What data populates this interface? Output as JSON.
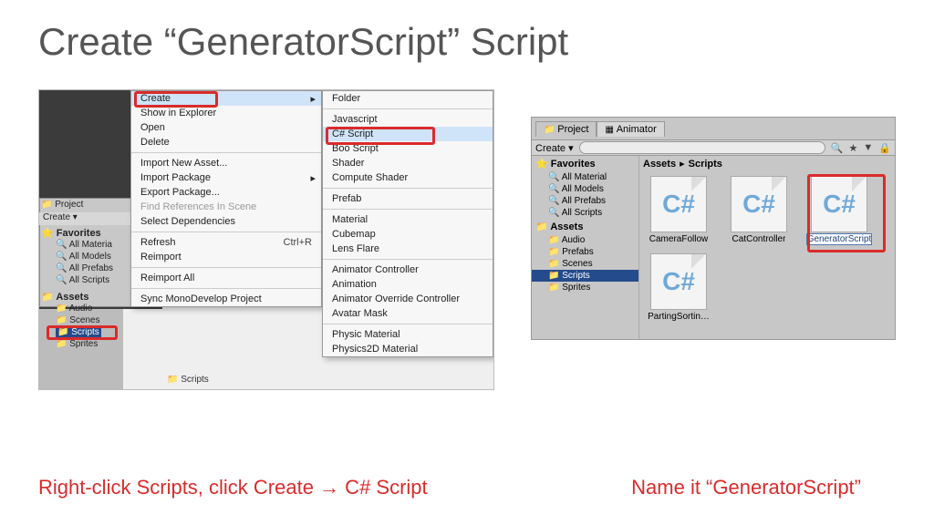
{
  "slide": {
    "title": "Create “GeneratorScript” Script"
  },
  "captions": {
    "left": "Right-click Scripts, click Create → C# Script",
    "right": "Name it “GeneratorScript”"
  },
  "left": {
    "project_tab": "Project",
    "create_toolbar": "Create ▾",
    "favorites_header": "Favorites",
    "favorites": [
      "All Materia",
      "All Models",
      "All Prefabs",
      "All Scripts"
    ],
    "assets_header": "Assets",
    "folders": [
      "Audio",
      "Scenes",
      "Scripts",
      "Sprites"
    ],
    "selected_folder": "Scripts",
    "bottom_folder": "Scripts",
    "menu_a": {
      "items": [
        {
          "label": "Create",
          "sub": true,
          "highlight": true
        },
        {
          "label": "Show in Explorer"
        },
        {
          "label": "Open"
        },
        {
          "label": "Delete"
        },
        {
          "sep": true
        },
        {
          "label": "Import New Asset..."
        },
        {
          "label": "Import Package",
          "sub": true
        },
        {
          "label": "Export Package..."
        },
        {
          "label": "Find References In Scene",
          "disabled": true
        },
        {
          "label": "Select Dependencies"
        },
        {
          "sep": true
        },
        {
          "label": "Refresh",
          "shortcut": "Ctrl+R"
        },
        {
          "label": "Reimport"
        },
        {
          "sep": true
        },
        {
          "label": "Reimport All"
        },
        {
          "sep": true
        },
        {
          "label": "Sync MonoDevelop Project"
        }
      ]
    },
    "menu_b": {
      "items": [
        {
          "label": "Folder"
        },
        {
          "sep": true
        },
        {
          "label": "Javascript"
        },
        {
          "label": "C# Script",
          "highlight": true
        },
        {
          "label": "Boo Script"
        },
        {
          "label": "Shader"
        },
        {
          "label": "Compute Shader"
        },
        {
          "sep": true
        },
        {
          "label": "Prefab"
        },
        {
          "sep": true
        },
        {
          "label": "Material"
        },
        {
          "label": "Cubemap"
        },
        {
          "label": "Lens Flare"
        },
        {
          "sep": true
        },
        {
          "label": "Animator Controller"
        },
        {
          "label": "Animation"
        },
        {
          "label": "Animator Override Controller"
        },
        {
          "label": "Avatar Mask"
        },
        {
          "sep": true
        },
        {
          "label": "Physic Material"
        },
        {
          "label": "Physics2D Material"
        }
      ]
    }
  },
  "right": {
    "tabs": {
      "project": "Project",
      "animator": "Animator"
    },
    "create_toolbar": "Create ▾",
    "favorites_header": "Favorites",
    "favorites": [
      "All Material",
      "All Models",
      "All Prefabs",
      "All Scripts"
    ],
    "assets_header": "Assets",
    "folders": [
      "Audio",
      "Prefabs",
      "Scenes",
      "Scripts",
      "Sprites"
    ],
    "selected_folder": "Scripts",
    "breadcrumb": {
      "root": "Assets",
      "sep": "▸",
      "leaf": "Scripts"
    },
    "grid": [
      {
        "glyph": "C#",
        "label": "CameraFollow"
      },
      {
        "glyph": "C#",
        "label": "CatController"
      },
      {
        "glyph": "C#",
        "label": "GeneratorScript",
        "editing": true
      },
      {
        "glyph": "C#",
        "label": "PartingSortin…"
      }
    ],
    "toolbar_icons": {
      "search": "🔍",
      "star": "★",
      "tag": "▼",
      "lock": "🔒"
    }
  }
}
